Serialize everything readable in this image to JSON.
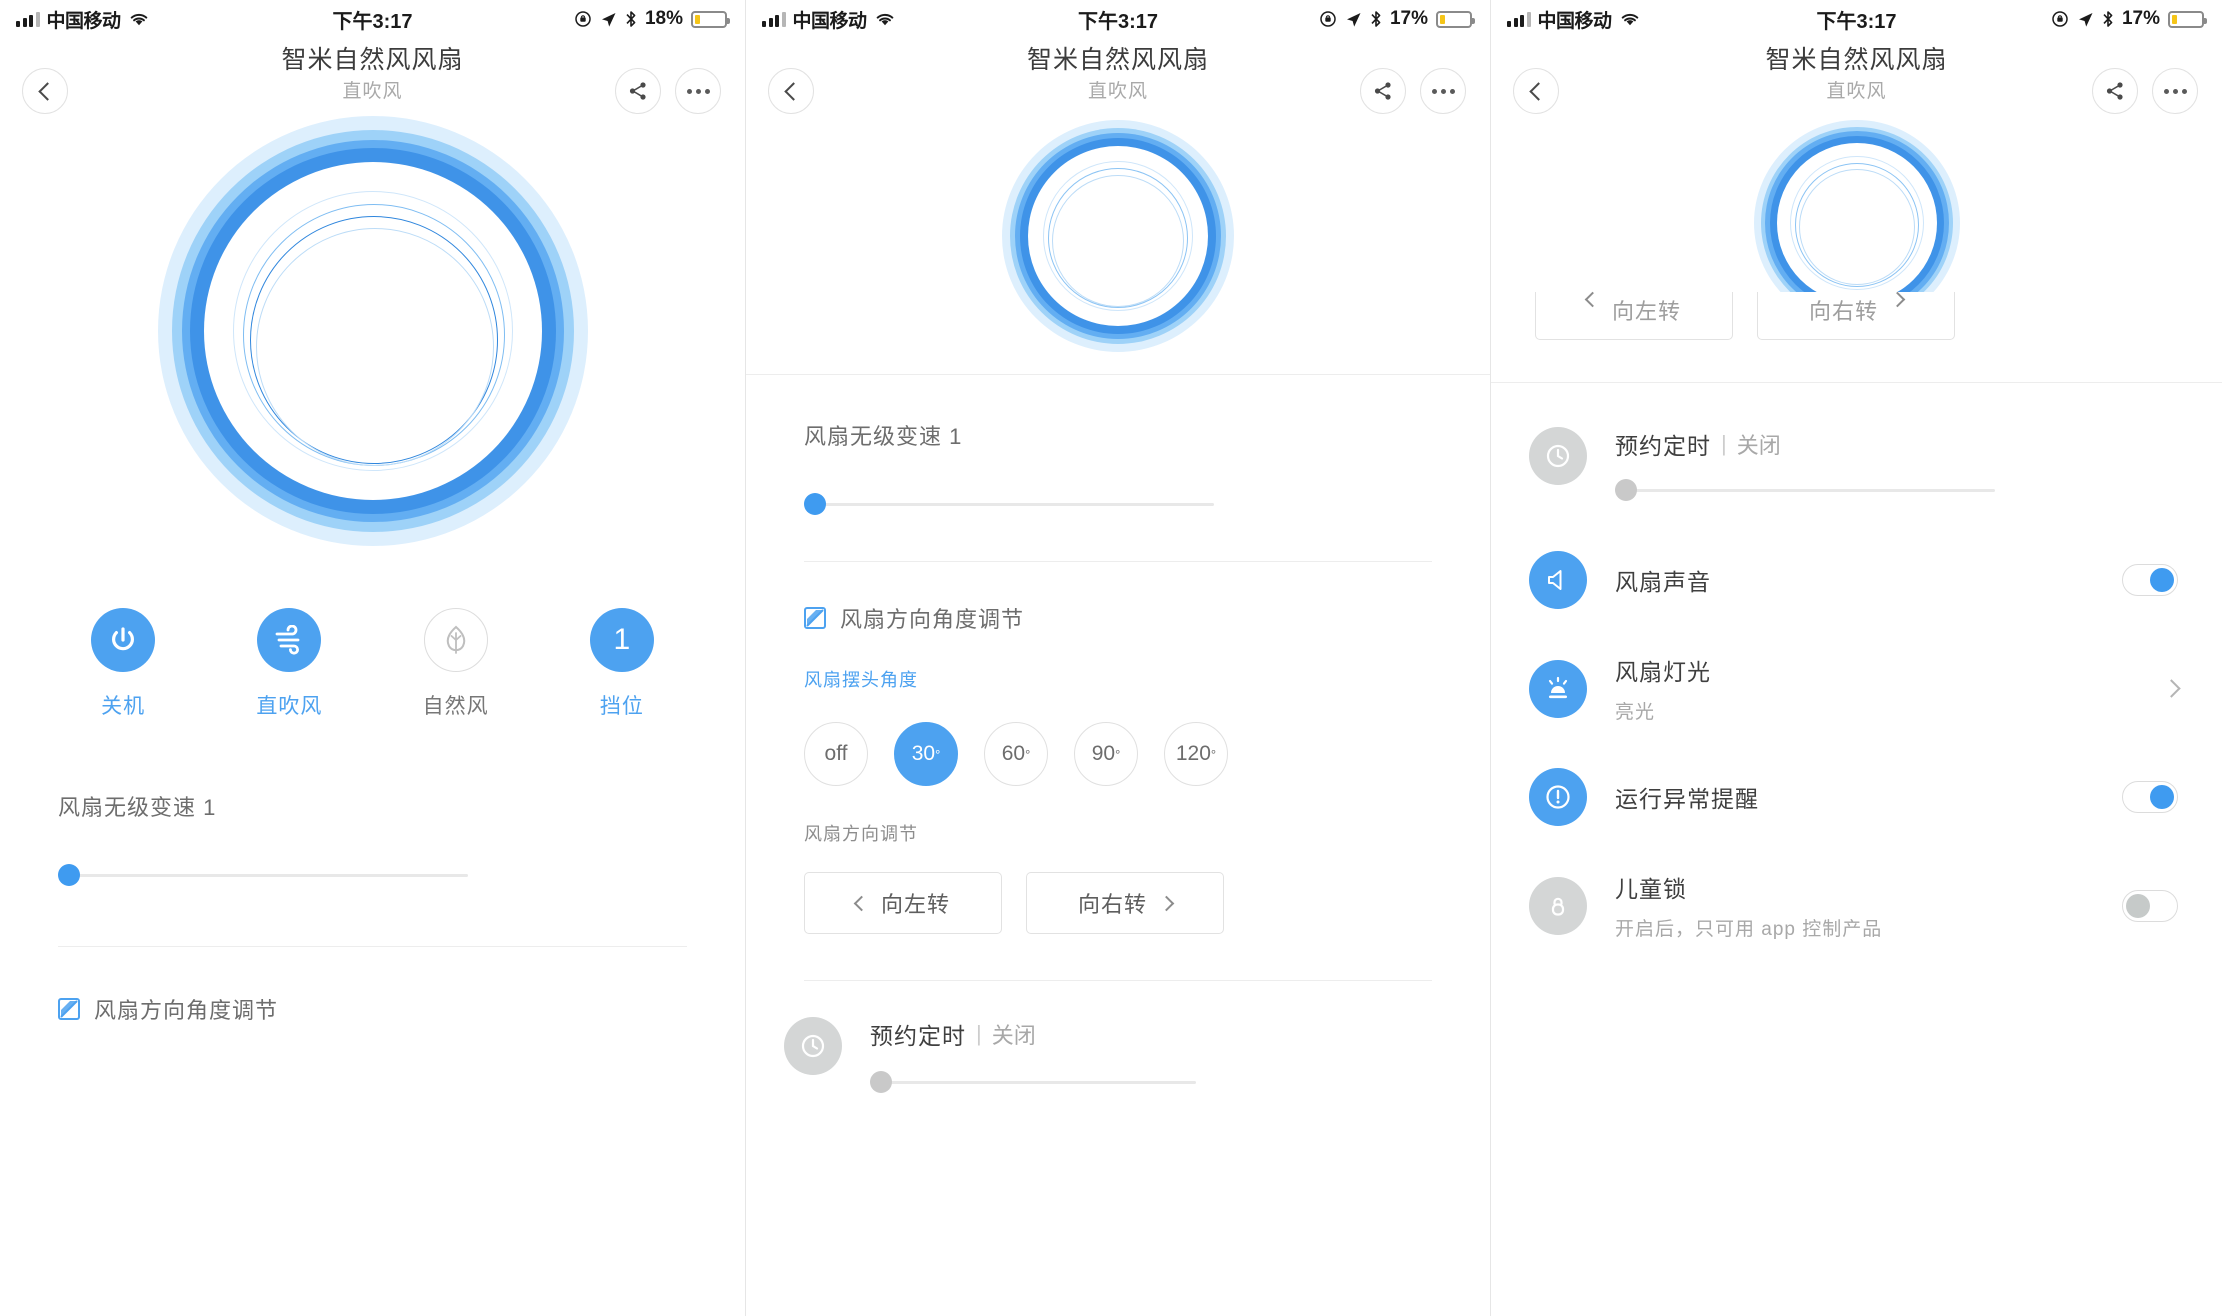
{
  "device": {
    "name": "智米自然风风扇",
    "mode_sub": "直吹风"
  },
  "status_bars": [
    {
      "carrier": "中国移动",
      "time": "下午3:17",
      "battery_pct": "18%",
      "battery_level": 18
    },
    {
      "carrier": "中国移动",
      "time": "下午3:17",
      "battery_pct": "17%",
      "battery_level": 17
    },
    {
      "carrier": "中国移动",
      "time": "下午3:17",
      "battery_pct": "17%",
      "battery_level": 17
    }
  ],
  "nav": {
    "back_icon": "chevron-left-icon",
    "share_icon": "share-icon",
    "more_icon": "ellipsis-icon"
  },
  "controls": [
    {
      "label": "关机",
      "icon": "power-icon",
      "active": true
    },
    {
      "label": "直吹风",
      "icon": "wind-icon",
      "active": true
    },
    {
      "label": "自然风",
      "icon": "leaf-icon",
      "active": false
    },
    {
      "label": "挡位",
      "icon": "gear-level",
      "value": "1",
      "active": true
    }
  ],
  "speed": {
    "title": "风扇无级变速 1",
    "value": 1,
    "min": 1,
    "max": 100,
    "percent": 1
  },
  "direction_section": {
    "title": "风扇方向角度调节",
    "icon": "hatched-square-icon",
    "swing_label": "风扇摆头角度",
    "angles": [
      {
        "label": "off",
        "selected": false
      },
      {
        "label": "30",
        "unit": "°",
        "selected": true
      },
      {
        "label": "60",
        "unit": "°",
        "selected": false
      },
      {
        "label": "90",
        "unit": "°",
        "selected": false
      },
      {
        "label": "120",
        "unit": "°",
        "selected": false
      }
    ],
    "adjust_label": "风扇方向调节",
    "left_button": "向左转",
    "right_button": "向右转"
  },
  "timer": {
    "title": "预约定时",
    "separator": "|",
    "value": "关闭",
    "icon": "clock-icon",
    "percent": 0
  },
  "settings": [
    {
      "title": "风扇声音",
      "icon": "speaker-icon",
      "icon_active": true,
      "control": "toggle",
      "toggle_on": true
    },
    {
      "title": "风扇灯光",
      "subtitle": "亮光",
      "icon": "light-icon",
      "icon_active": true,
      "control": "chevron",
      "chevron_icon": "chevron-right-icon"
    },
    {
      "title": "运行异常提醒",
      "icon": "alert-icon",
      "icon_active": true,
      "control": "toggle",
      "toggle_on": true
    },
    {
      "title": "儿童锁",
      "subtitle": "开启后，只可用 app 控制产品",
      "icon": "lock-icon",
      "icon_active": false,
      "control": "toggle",
      "toggle_on": false
    }
  ],
  "colors": {
    "accent": "#4da2f0",
    "ring_outer": "#d6ecfd",
    "ring_mid": "#63aef2",
    "ring_inner": "#3f93e8",
    "track": "#e8e8e8",
    "text_primary": "#3f3f3f",
    "text_muted": "#a8a8a8"
  }
}
